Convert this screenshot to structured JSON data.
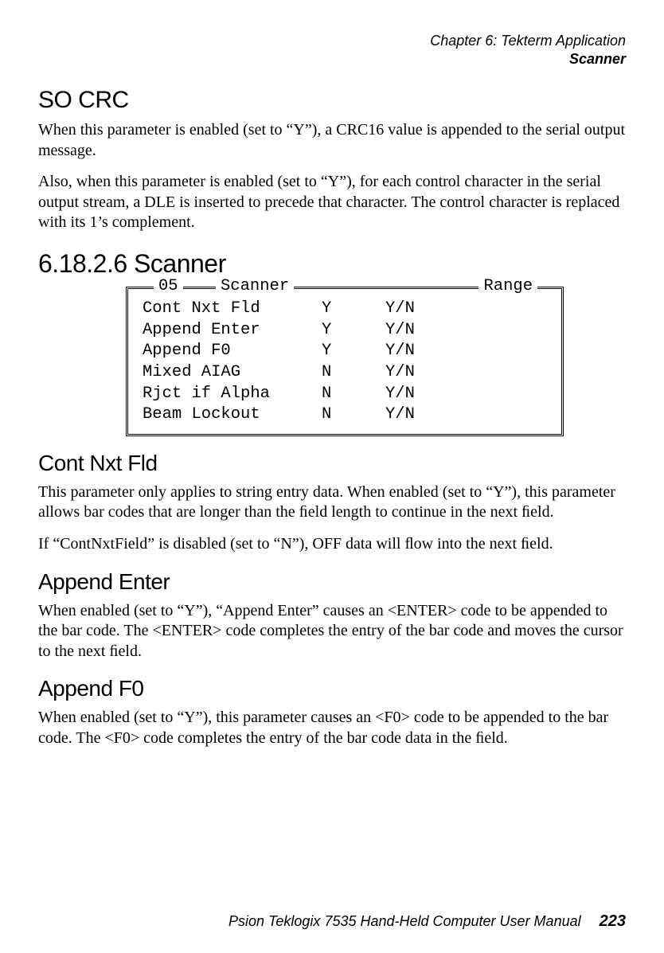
{
  "header": {
    "chapter": "Chapter 6: Tekterm Application",
    "section": "Scanner"
  },
  "so_crc": {
    "heading": "SO CRC",
    "p1": "When this parameter is enabled (set to “Y”), a CRC16 value is appended to the serial output message.",
    "p2": "Also, when this parameter is enabled (set to “Y”), for each control character in the serial output stream, a DLE is inserted to precede that character. The control character is replaced with its 1’s complement."
  },
  "scanner_section": {
    "heading": "6.18.2.6  Scanner",
    "legend_num": "05",
    "legend_title": "Scanner",
    "legend_range": "Range",
    "rows": [
      {
        "label": "Cont Nxt Fld",
        "value": "Y",
        "range": "Y/N"
      },
      {
        "label": "Append Enter",
        "value": "Y",
        "range": "Y/N"
      },
      {
        "label": "Append F0",
        "value": "Y",
        "range": "Y/N"
      },
      {
        "label": "Mixed AIAG",
        "value": "N",
        "range": "Y/N"
      },
      {
        "label": "Rjct if Alpha",
        "value": "N",
        "range": "Y/N"
      },
      {
        "label": "Beam Lockout",
        "value": "N",
        "range": "Y/N"
      }
    ]
  },
  "cont_nxt_fld": {
    "heading": "Cont Nxt Fld",
    "p1": "This parameter only applies to string entry data. When enabled (set to “Y”), this parameter allows bar codes that are longer than the ﬁeld length to continue in the next ﬁeld.",
    "p2": "If “ContNxtField” is disabled (set to “N”), OFF data will ﬂow into the next ﬁeld."
  },
  "append_enter": {
    "heading": "Append Enter",
    "p1": "When enabled (set to “Y”), “Append Enter” causes an <ENTER> code to be appended to the bar code. The <ENTER> code completes the entry of the bar code and moves the cursor to the next ﬁeld."
  },
  "append_f0": {
    "heading": "Append F0",
    "p1": "When enabled (set to “Y”), this parameter causes an <F0> code to be appended to the bar code. The <F0> code completes the entry of the bar code data in the ﬁeld."
  },
  "footer": {
    "text": "Psion Teklogix 7535 Hand-Held Computer User Manual",
    "page": "223"
  }
}
